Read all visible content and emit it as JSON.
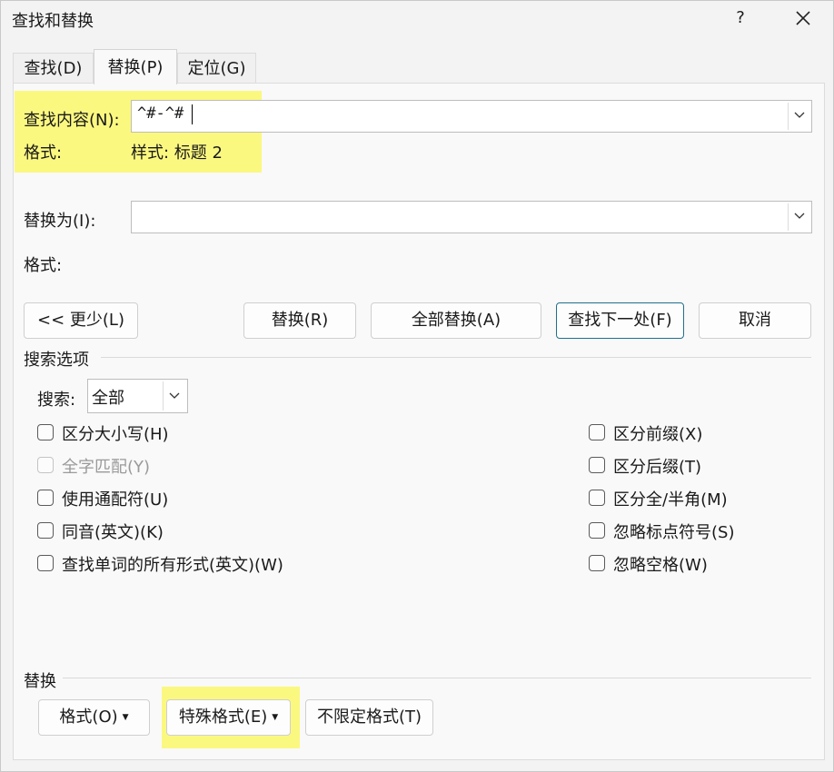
{
  "window": {
    "title": "查找和替换",
    "help_label": "?"
  },
  "tabs": [
    {
      "label": "查找(D)",
      "active": false
    },
    {
      "label": "替换(P)",
      "active": true
    },
    {
      "label": "定位(G)",
      "active": false
    }
  ],
  "find": {
    "label": "查找内容(N):",
    "value": "^#-^#",
    "format_label": "格式:",
    "format_value": "样式: 标题 2"
  },
  "replace": {
    "label": "替换为(I):",
    "value": "",
    "format_label": "格式:",
    "format_value": ""
  },
  "buttons": {
    "less": "<< 更少(L)",
    "replace": "替换(R)",
    "replace_all": "全部替换(A)",
    "find_next": "查找下一处(F)",
    "cancel": "取消"
  },
  "search_options": {
    "title": "搜索选项",
    "search_label": "搜索:",
    "search_value": "全部",
    "left": [
      {
        "label": "区分大小写(H)",
        "checked": false,
        "disabled": false
      },
      {
        "label": "全字匹配(Y)",
        "checked": false,
        "disabled": true
      },
      {
        "label": "使用通配符(U)",
        "checked": false,
        "disabled": false
      },
      {
        "label": "同音(英文)(K)",
        "checked": false,
        "disabled": false
      },
      {
        "label": "查找单词的所有形式(英文)(W)",
        "checked": false,
        "disabled": false
      }
    ],
    "right": [
      {
        "label": "区分前缀(X)",
        "checked": false,
        "disabled": false
      },
      {
        "label": "区分后缀(T)",
        "checked": false,
        "disabled": false
      },
      {
        "label": "区分全/半角(M)",
        "checked": false,
        "disabled": false
      },
      {
        "label": "忽略标点符号(S)",
        "checked": false,
        "disabled": false
      },
      {
        "label": "忽略空格(W)",
        "checked": false,
        "disabled": false
      }
    ]
  },
  "replace_group": {
    "title": "替换",
    "format_button": "格式(O)",
    "special_button": "特殊格式(E)",
    "no_format_button": "不限定格式(T)"
  },
  "colors": {
    "highlight": "#fbf880",
    "default_button_border": "#1f6f8f"
  }
}
